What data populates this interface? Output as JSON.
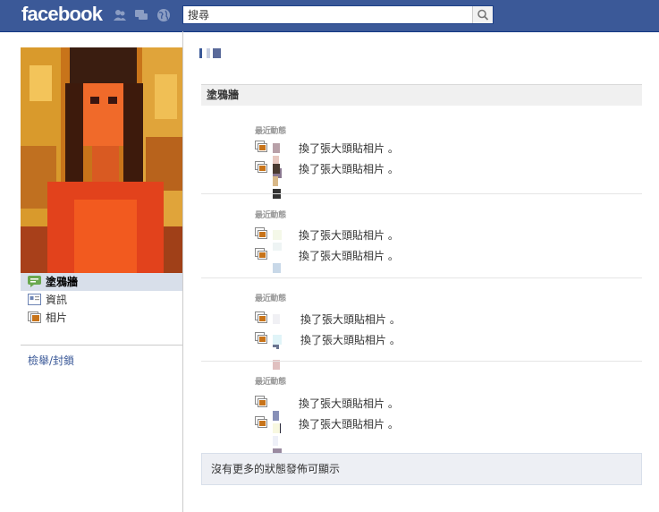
{
  "header": {
    "logo": "facebook",
    "search": {
      "placeholder": "搜尋",
      "value": "搜尋"
    }
  },
  "sidebar": {
    "nav": [
      {
        "label": "塗鴉牆",
        "icon": "wall-icon",
        "active": true
      },
      {
        "label": "資訊",
        "icon": "info-icon",
        "active": false
      },
      {
        "label": "相片",
        "icon": "photos-icon",
        "active": false
      }
    ],
    "report_link": "檢舉/封鎖"
  },
  "main": {
    "wall_title": "塗鴉牆",
    "stories": [
      {
        "label": "最近動態",
        "entries": [
          {
            "text": "換了張大頭貼相片 。"
          },
          {
            "text": "換了張大頭貼相片 。"
          }
        ]
      },
      {
        "label": "最近動態",
        "entries": [
          {
            "text": "換了張大頭貼相片 。"
          },
          {
            "text": "換了張大頭貼相片 。"
          }
        ]
      },
      {
        "label": "最近動態",
        "entries": [
          {
            "text": "換了張大頭貼相片 。"
          },
          {
            "text": "換了張大頭貼相片 。"
          }
        ]
      },
      {
        "label": "最近動態",
        "entries": [
          {
            "text": "換了張大頭貼相片 。"
          },
          {
            "text": "換了張大頭貼相片 。"
          }
        ]
      }
    ],
    "no_more_text": "沒有更多的狀態發佈可顯示"
  },
  "colors": {
    "brand": "#3b5998",
    "active_nav": "#d8dfea",
    "link": "#3b5998"
  }
}
